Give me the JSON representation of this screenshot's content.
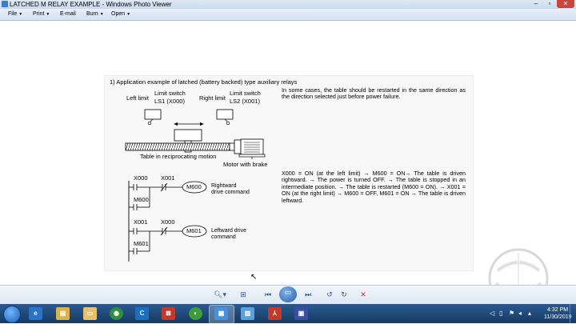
{
  "window": {
    "title": "LATCHED M RELAY EXAMPLE - Windows Photo Viewer"
  },
  "menu": {
    "file": "File",
    "print": "Print",
    "email": "E-mail",
    "burn": "Burn",
    "open": "Open"
  },
  "doc": {
    "heading": "1)    Application example of latched (battery backed) type auxiliary relays",
    "left_limit": "Left limit",
    "limit_switch_ls1": "Limit switch",
    "ls1": "LS1 (X000)",
    "right_limit": "Right limit",
    "limit_switch_ls2": "Limit switch",
    "ls2": "LS2 (X001)",
    "table_caption": "Table in reciprocating motion",
    "motor_caption": "Motor with brake",
    "para1": "In some cases, the table should be restarted in the same direction as the direction selected just before power failure.",
    "para2": "X000 = ON (at the left limit) → M600 = ON→ The table is driven rightward. → The power is turned OFF. → The table is stopped in an intermediate position. → The table is restarted (M600 = ON). → X001 = ON (at the right limit) → M600 = OFF, M601 = ON → The table is driven leftward.",
    "rung1": {
      "contact1": "X000",
      "contact2": "X001",
      "coil": "M600",
      "self": "M600",
      "comment": "Rightward drive command"
    },
    "rung2": {
      "contact1": "X001",
      "contact2": "X000",
      "coil": "M601",
      "self": "M601",
      "comment": "Leftward drive command"
    }
  },
  "taskbar": {
    "time": "4:32 PM",
    "date": "11/30/2019"
  },
  "colors": {
    "taskbar": "#1e4a7a",
    "titlebar": "#d4e2f2",
    "accent": "#2b5b9a"
  }
}
